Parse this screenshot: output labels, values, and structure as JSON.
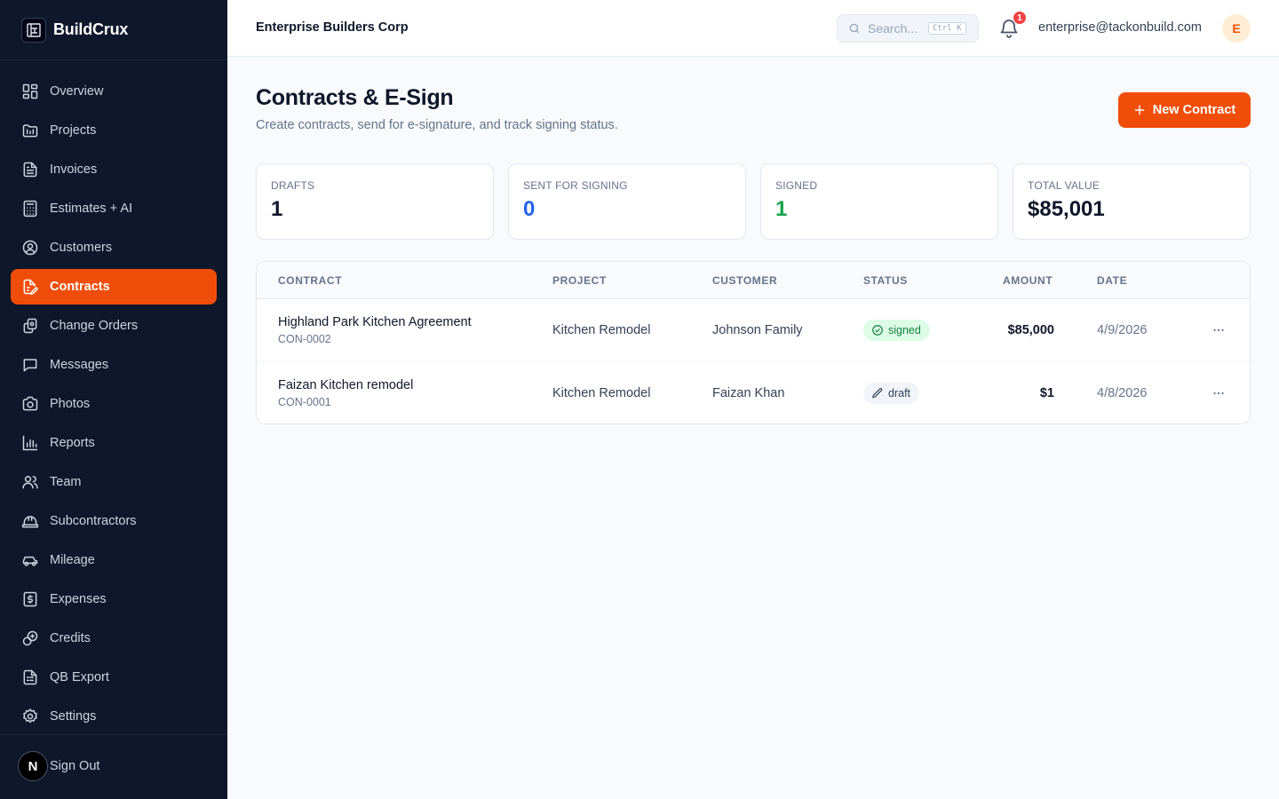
{
  "brand": {
    "name": "BuildCrux"
  },
  "sidebar": {
    "items": [
      {
        "label": "Overview",
        "icon": "grid-icon",
        "active": false
      },
      {
        "label": "Projects",
        "icon": "folder-icon",
        "active": false
      },
      {
        "label": "Invoices",
        "icon": "file-text-icon",
        "active": false
      },
      {
        "label": "Estimates + AI",
        "icon": "calculator-icon",
        "active": false
      },
      {
        "label": "Customers",
        "icon": "user-circle-icon",
        "active": false
      },
      {
        "label": "Contracts",
        "icon": "file-pen-icon",
        "active": true
      },
      {
        "label": "Change Orders",
        "icon": "files-icon",
        "active": false
      },
      {
        "label": "Messages",
        "icon": "message-icon",
        "active": false
      },
      {
        "label": "Photos",
        "icon": "camera-icon",
        "active": false
      },
      {
        "label": "Reports",
        "icon": "bar-chart-icon",
        "active": false
      },
      {
        "label": "Team",
        "icon": "users-icon",
        "active": false
      },
      {
        "label": "Subcontractors",
        "icon": "hard-hat-icon",
        "active": false
      },
      {
        "label": "Mileage",
        "icon": "car-icon",
        "active": false
      },
      {
        "label": "Expenses",
        "icon": "receipt-dollar-icon",
        "active": false
      },
      {
        "label": "Credits",
        "icon": "coins-icon",
        "active": false
      },
      {
        "label": "QB Export",
        "icon": "spreadsheet-icon",
        "active": false
      },
      {
        "label": "Settings",
        "icon": "gear-icon",
        "active": false
      }
    ],
    "signout": {
      "label": "Sign Out",
      "badge": "N"
    }
  },
  "header": {
    "company": "Enterprise Builders Corp",
    "search_placeholder": "Search...",
    "search_shortcut": "Ctrl K",
    "notification_count": "1",
    "user_email": "enterprise@tackonbuild.com",
    "avatar_initial": "E"
  },
  "page": {
    "title": "Contracts & E-Sign",
    "subtitle": "Create contracts, send for e-signature, and track signing status.",
    "new_button": "New Contract"
  },
  "stats": [
    {
      "label": "DRAFTS",
      "value": "1",
      "color": "#0f172a"
    },
    {
      "label": "SENT FOR SIGNING",
      "value": "0",
      "color": "#2563eb"
    },
    {
      "label": "SIGNED",
      "value": "1",
      "color": "#16a34a"
    },
    {
      "label": "TOTAL VALUE",
      "value": "$85,001",
      "color": "#0f172a"
    }
  ],
  "table": {
    "columns": [
      "CONTRACT",
      "PROJECT",
      "CUSTOMER",
      "STATUS",
      "AMOUNT",
      "DATE"
    ],
    "rows": [
      {
        "title": "Highland Park Kitchen Agreement",
        "id": "CON-0002",
        "project": "Kitchen Remodel",
        "customer": "Johnson Family",
        "status": "signed",
        "amount": "$85,000",
        "date": "4/9/2026"
      },
      {
        "title": "Faizan Kitchen remodel",
        "id": "CON-0001",
        "project": "Kitchen Remodel",
        "customer": "Faizan Khan",
        "status": "draft",
        "amount": "$1",
        "date": "4/8/2026"
      }
    ]
  }
}
